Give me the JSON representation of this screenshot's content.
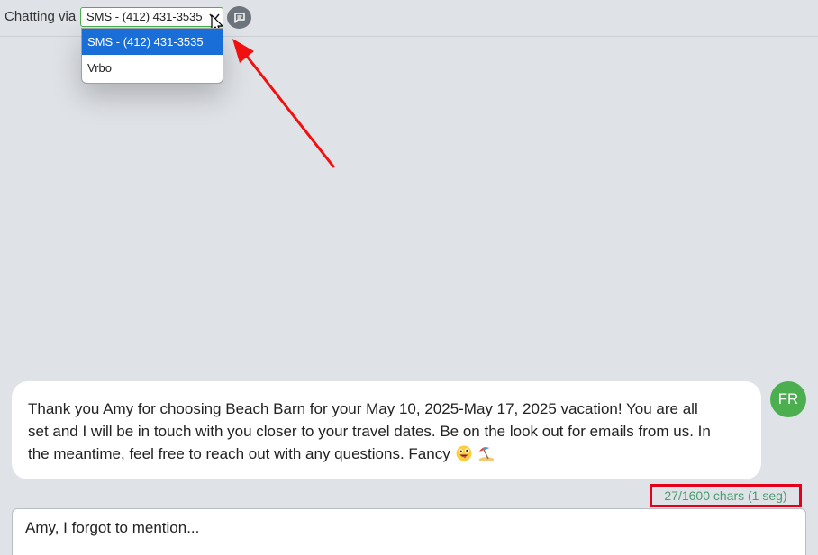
{
  "header": {
    "chatting_label": "Chatting via",
    "selected_channel": "SMS - (412) 431-3535",
    "message_icon": "message-square-icon"
  },
  "dropdown": {
    "options": [
      "SMS - (412) 431-3535",
      "Vrbo"
    ],
    "selected_index": 0
  },
  "message": {
    "line1": "Thank you Amy for choosing Beach Barn for your May 10, 2025-May 17, 2025 vacation!  You are all",
    "line2": "set and I will be in touch with you closer to your travel dates. Be on the look out for emails from us. In",
    "line3": "the meantime, feel free to reach out with any questions. Fancy",
    "emojis": [
      "zany-face-emoji",
      "beach-umbrella-emoji"
    ],
    "avatar_initials": "FR"
  },
  "composer": {
    "char_count": "27/1600 chars (1 seg)",
    "draft_text": "Amy, I forgot to mention..."
  },
  "colors": {
    "background": "#dfe2e7",
    "selected_option": "#1a6ed8",
    "avatar": "#4bae4f",
    "highlight_box": "#e4001b",
    "annotation_arrow": "#f01010",
    "char_count_text": "#4a9c6e"
  }
}
